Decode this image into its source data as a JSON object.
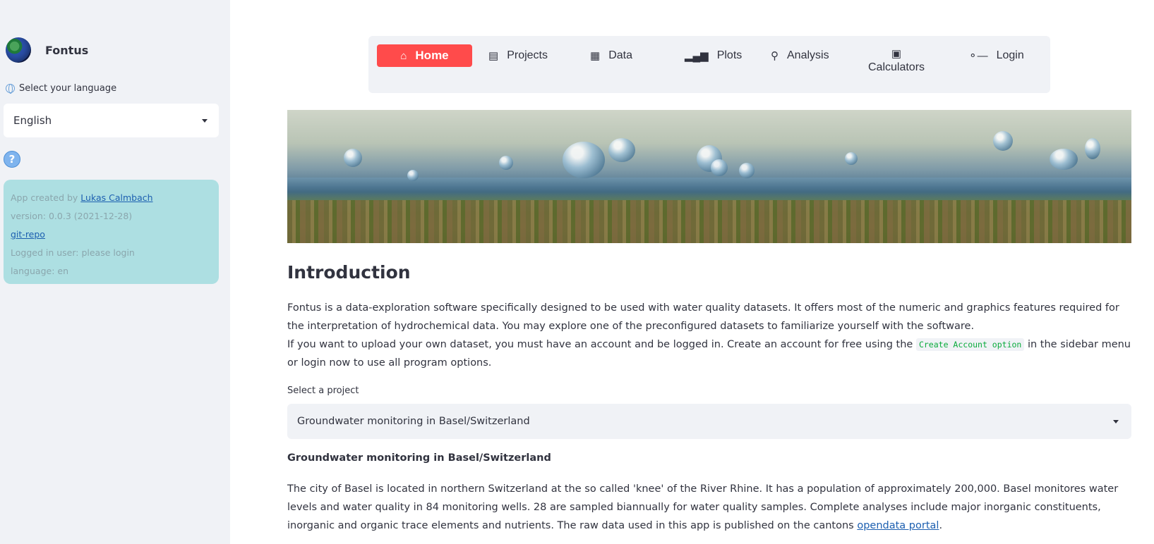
{
  "sidebar": {
    "app_name": "Fontus",
    "language_label": "Select your language",
    "language_value": "English",
    "help_icon": "?",
    "info": {
      "created_prefix": "App created by ",
      "author": "Lukas Calmbach",
      "version": "version: 0.0.3 (2021-12-28)",
      "repo_link": "git-repo",
      "logged_in": "Logged in user: please login",
      "language": "language: en"
    }
  },
  "nav": {
    "items": [
      {
        "label": "Home",
        "icon": "home-icon"
      },
      {
        "label": "Projects",
        "icon": "document-icon"
      },
      {
        "label": "Data",
        "icon": "table-icon"
      },
      {
        "label": "Plots",
        "icon": "bar-chart-icon"
      },
      {
        "label": "Analysis",
        "icon": "search-icon"
      },
      {
        "label": "Calculators",
        "icon": "calculator-icon"
      },
      {
        "label": "Login",
        "icon": "key-icon"
      }
    ],
    "active": "Home",
    "active_color": "#ff4b4b"
  },
  "main": {
    "title": "Introduction",
    "intro_line1": "Fontus is a data-exploration software specifically designed to be used with water quality datasets. It offers most of the numeric and graphics features required for the interpretation of hydrochemical data. You may explore one of the preconfigured datasets to familiarize yourself with the software.",
    "intro_line2_before": "If you want to upload your own dataset, you must have an account and be logged in. Create an account for free using the ",
    "intro_code": "Create Account option",
    "intro_line2_after": " in the sidebar menu or login now to use all program options.",
    "select_project_label": "Select a project",
    "selected_project": "Groundwater monitoring in Basel/Switzerland",
    "project_heading": "Groundwater monitoring in Basel/Switzerland",
    "project_desc": "The city of Basel is located in northern Switzerland at the so called 'knee' of the River Rhine. It has a population of approximately 200,000. Basel monitores water levels and water quality in 84 monitoring wells. 28 are sampled biannually for water quality samples. Complete analyses include major inorganic constituents, inorganic and organic trace elements and nutrients. The raw data used in this app is published on the cantons ",
    "project_link": "opendata portal",
    "project_desc_end": "."
  }
}
